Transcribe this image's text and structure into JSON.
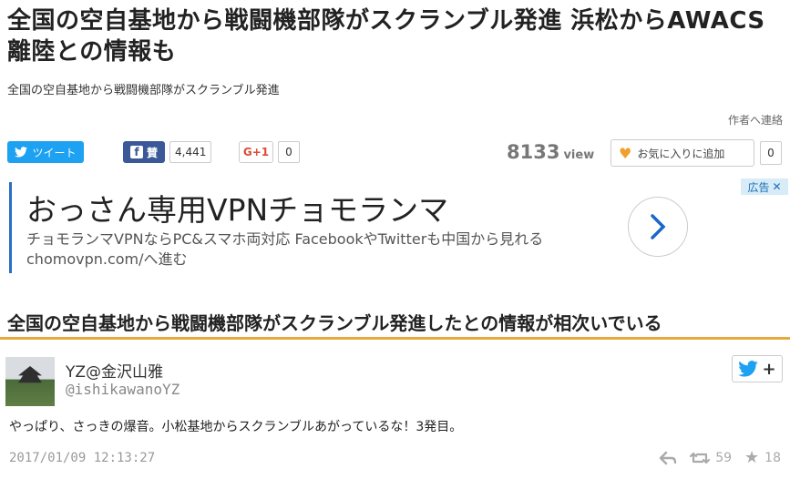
{
  "article": {
    "title": "全国の空自基地から戦闘機部隊がスクランブル発進 浜松からAWACS離陸との情報も",
    "summary": "全国の空自基地から戦闘機部隊がスクランブル発進",
    "author_link": "作者へ連絡"
  },
  "share": {
    "tweet_label": "ツイート",
    "facebook_label": "賛",
    "facebook_count": "4,441",
    "gplus_label": "G+1",
    "gplus_count": "0",
    "view_count": "8133",
    "view_unit": "view",
    "favorite_label": "お気に入りに追加",
    "favorite_count": "0"
  },
  "ad": {
    "badge": "広告",
    "title": "おっさん専用VPNチョモランマ",
    "description": "チョモランマVPNならPC&スマホ両対応 FacebookやTwitterも中国から見れる chomovpn.com/へ進む"
  },
  "section": {
    "heading": "全国の空自基地から戦闘機部隊がスクランブル発進したとの情報が相次いでいる"
  },
  "tweet": {
    "display_name": "YZ@金沢山雅",
    "handle": "@ishikawanoYZ",
    "text": "やっぱり、さっきの爆音。小松基地からスクランブルあがっているな！3発目。",
    "timestamp": "2017/01/09 12:13:27",
    "retweets": "59",
    "likes": "18"
  },
  "colors": {
    "twitter_blue": "#1da1f2",
    "facebook_blue": "#3b5998",
    "accent_orange": "#e6a93c",
    "ad_blue": "#2a6ebf"
  }
}
